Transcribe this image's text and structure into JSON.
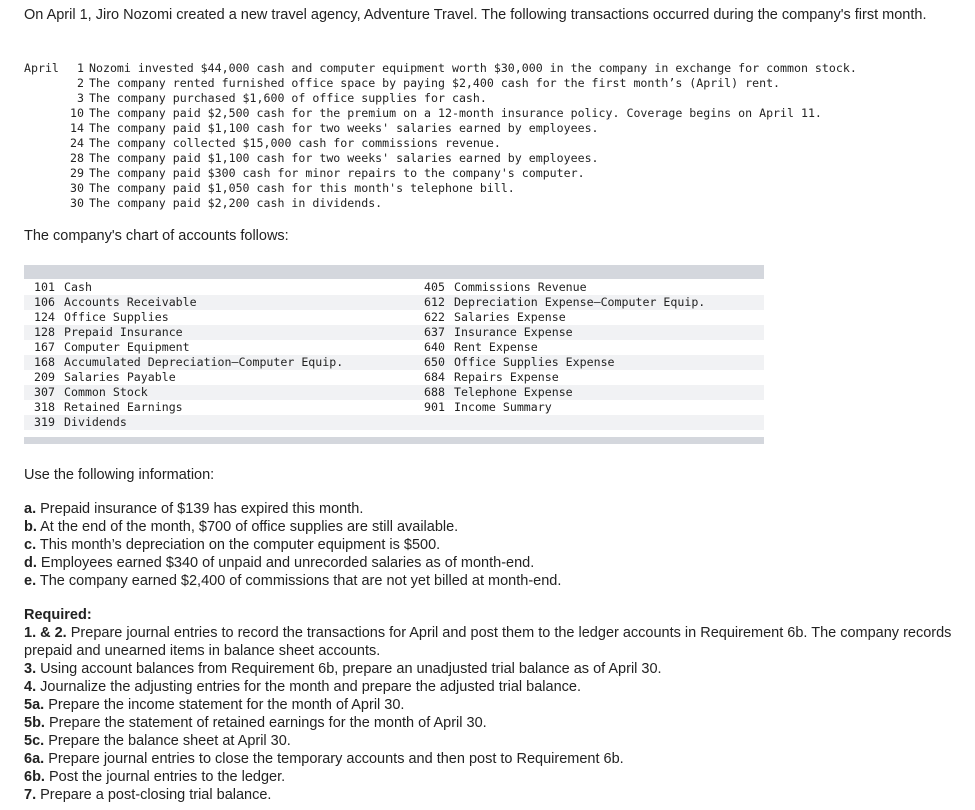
{
  "intro": "On April 1, Jiro Nozomi created a new travel agency, Adventure Travel. The following transactions occurred during the company's first month.",
  "transactions": {
    "month": "April",
    "rows": [
      {
        "day": "1",
        "text": "Nozomi invested $44,000 cash and computer equipment worth $30,000 in the company in exchange for common stock."
      },
      {
        "day": "2",
        "text": "The company rented furnished office space by paying $2,400 cash for the first month’s (April) rent."
      },
      {
        "day": "3",
        "text": "The company purchased $1,600 of office supplies for cash."
      },
      {
        "day": "10",
        "text": "The company paid $2,500 cash for the premium on a 12-month insurance policy. Coverage begins on April 11."
      },
      {
        "day": "14",
        "text": "The company paid $1,100 cash for two weeks' salaries earned by employees."
      },
      {
        "day": "24",
        "text": "The company collected $15,000 cash for commissions revenue."
      },
      {
        "day": "28",
        "text": "The company paid $1,100 cash for two weeks' salaries earned by employees."
      },
      {
        "day": "29",
        "text": "The company paid $300 cash for minor repairs to the company's computer."
      },
      {
        "day": "30",
        "text": "The company paid $1,050 cash for this month's telephone bill."
      },
      {
        "day": "30",
        "text": "The company paid $2,200 cash in dividends."
      }
    ]
  },
  "chart_of_accounts": {
    "heading": "The company's chart of accounts follows:",
    "rows": [
      {
        "left": {
          "no": "101",
          "name": "Cash"
        },
        "right": {
          "no": "405",
          "name": "Commissions Revenue"
        }
      },
      {
        "left": {
          "no": "106",
          "name": "Accounts Receivable"
        },
        "right": {
          "no": "612",
          "name": "Depreciation Expense—Computer Equip."
        }
      },
      {
        "left": {
          "no": "124",
          "name": "Office Supplies"
        },
        "right": {
          "no": "622",
          "name": "Salaries Expense"
        }
      },
      {
        "left": {
          "no": "128",
          "name": "Prepaid Insurance"
        },
        "right": {
          "no": "637",
          "name": "Insurance Expense"
        }
      },
      {
        "left": {
          "no": "167",
          "name": "Computer Equipment"
        },
        "right": {
          "no": "640",
          "name": "Rent Expense"
        }
      },
      {
        "left": {
          "no": "168",
          "name": "Accumulated Depreciation—Computer Equip."
        },
        "right": {
          "no": "650",
          "name": "Office Supplies Expense"
        }
      },
      {
        "left": {
          "no": "209",
          "name": "Salaries Payable"
        },
        "right": {
          "no": "684",
          "name": "Repairs Expense"
        }
      },
      {
        "left": {
          "no": "307",
          "name": "Common Stock"
        },
        "right": {
          "no": "688",
          "name": "Telephone Expense"
        }
      },
      {
        "left": {
          "no": "318",
          "name": "Retained Earnings"
        },
        "right": {
          "no": "901",
          "name": "Income Summary"
        }
      },
      {
        "left": {
          "no": "319",
          "name": "Dividends"
        },
        "right": {
          "no": "",
          "name": ""
        }
      }
    ]
  },
  "info": {
    "heading": "Use the following information:",
    "items": [
      {
        "label": "a.",
        "text": "Prepaid insurance of $139 has expired this month."
      },
      {
        "label": "b.",
        "text": "At the end of the month, $700 of office supplies are still available."
      },
      {
        "label": "c.",
        "text": "This month’s depreciation on the computer equipment is $500."
      },
      {
        "label": "d.",
        "text": "Employees earned $340 of unpaid and unrecorded salaries as of month-end."
      },
      {
        "label": "e.",
        "text": "The company earned $2,400 of commissions that are not yet billed at month-end."
      }
    ]
  },
  "required": {
    "title": "Required:",
    "items": [
      {
        "label": "1. & 2.",
        "text": "Prepare journal entries to record the transactions for April and post them to the ledger accounts in Requirement 6b. The company records prepaid and unearned items in balance sheet accounts."
      },
      {
        "label": "3.",
        "text": "Using account balances from Requirement 6b, prepare an unadjusted trial balance as of April 30."
      },
      {
        "label": "4.",
        "text": "Journalize the adjusting entries for the month and prepare the adjusted trial balance."
      },
      {
        "label": "5a.",
        "text": "Prepare the income statement for the month of April 30."
      },
      {
        "label": "5b.",
        "text": "Prepare the statement of retained earnings for the month of April 30."
      },
      {
        "label": "5c.",
        "text": "Prepare the balance sheet at April 30."
      },
      {
        "label": "6a.",
        "text": "Prepare journal entries to close the temporary accounts and then post to Requirement 6b."
      },
      {
        "label": "6b.",
        "text": "Post the journal entries to the ledger."
      },
      {
        "label": "7.",
        "text": "Prepare a post-closing trial balance."
      }
    ]
  }
}
